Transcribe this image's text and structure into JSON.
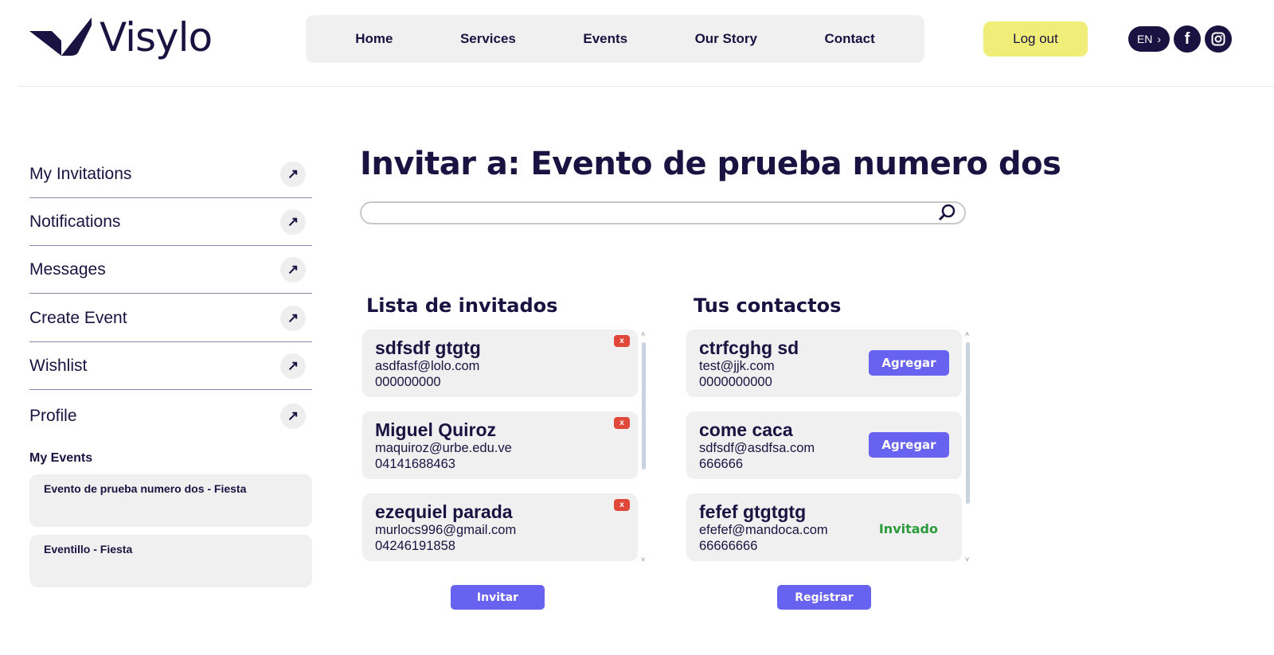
{
  "header": {
    "brand": "Visylo",
    "nav": [
      "Home",
      "Services",
      "Events",
      "Our Story",
      "Contact"
    ],
    "logout": "Log out",
    "lang": "EN"
  },
  "sidebar": {
    "items": [
      "My Invitations",
      "Notifications",
      "Messages",
      "Create Event",
      "Wishlist",
      "Profile"
    ],
    "my_events_label": "My Events",
    "events": [
      "Evento de prueba numero dos - Fiesta",
      "Eventillo - Fiesta"
    ]
  },
  "main": {
    "title": "Invitar a: Evento de prueba numero dos",
    "search": {
      "value": "",
      "placeholder": ""
    },
    "guests": {
      "title": "Lista de invitados",
      "remove_label": "x",
      "items": [
        {
          "name": "sdfsdf gtgtg",
          "email": "asdfasf@lolo.com",
          "phone": "000000000"
        },
        {
          "name": "Miguel Quiroz",
          "email": "maquiroz@urbe.edu.ve",
          "phone": "04141688463"
        },
        {
          "name": "ezequiel parada",
          "email": "murlocs996@gmail.com",
          "phone": "04246191858"
        }
      ],
      "button": "Invitar"
    },
    "contacts": {
      "title": "Tus contactos",
      "items": [
        {
          "name": "ctrfcghg sd",
          "email": "test@jjk.com",
          "phone": "0000000000",
          "action": "Agregar"
        },
        {
          "name": "come caca",
          "email": "sdfsdf@asdfsa.com",
          "phone": "666666",
          "action": "Agregar"
        },
        {
          "name": "fefef gtgtgtg",
          "email": "efefef@mandoca.com",
          "phone": "66666666",
          "status": "Invitado"
        }
      ],
      "button": "Registrar"
    }
  },
  "colors": {
    "primary": "#1a1240",
    "accent": "#6862f0",
    "logout": "#f0ee78",
    "remove": "#e0483a",
    "invited": "#2a9a3a"
  }
}
